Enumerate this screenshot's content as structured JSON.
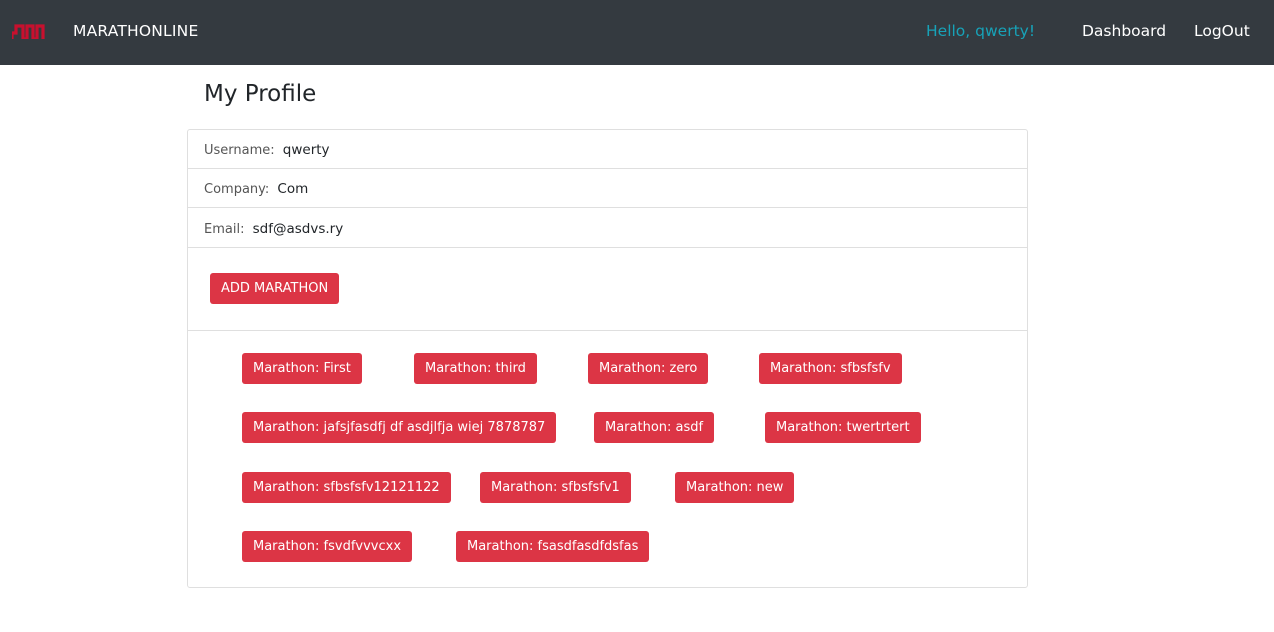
{
  "nav": {
    "brand": "MARATHONLINE",
    "greeting": "Hello, qwerty!",
    "dashboard": "Dashboard",
    "logout": "LogOut",
    "logo_icon": "mm-logo-icon"
  },
  "page": {
    "title": "My Profile"
  },
  "profile": {
    "username_label": "Username:",
    "username": "qwerty",
    "company_label": "Company:",
    "company": "Com",
    "email_label": "Email:",
    "email": "sdf@asdvs.ry"
  },
  "actions": {
    "add_marathon": "ADD MARATHON"
  },
  "marathons": [
    "Marathon: First",
    "Marathon: third",
    "Marathon: zero",
    "Marathon: sfbsfsfv",
    "Marathon: jafsjfasdfj df asdjlfja wiej 7878787",
    "Marathon: asdf",
    "Marathon: twertrtert",
    "Marathon: sfbsfsfv12121122",
    "Marathon: sfbsfsfv1",
    "Marathon: new",
    "Marathon: fsvdfvvvcxx",
    "Marathon: fsasdfasdfdsfas"
  ],
  "colors": {
    "navbar": "#343a40",
    "accent_red": "#dc3545",
    "greeting": "#17a2b8"
  }
}
